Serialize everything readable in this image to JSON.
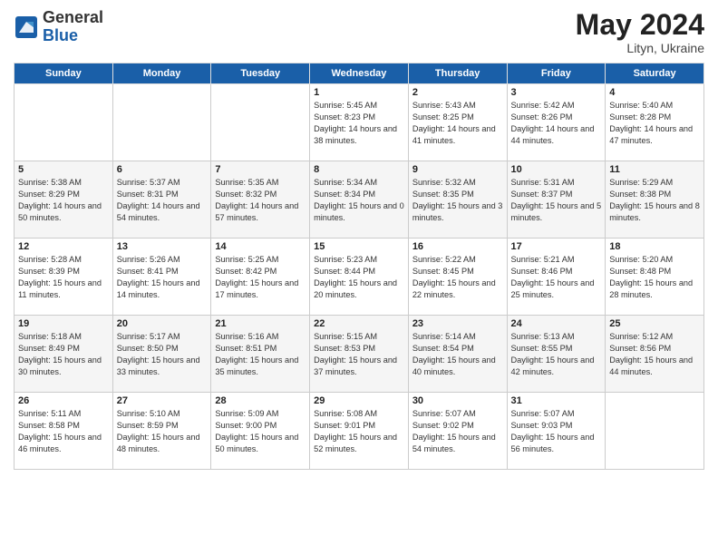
{
  "header": {
    "logo": {
      "line1": "General",
      "line2": "Blue"
    },
    "title": "May 2024",
    "location": "Lityn, Ukraine"
  },
  "weekdays": [
    "Sunday",
    "Monday",
    "Tuesday",
    "Wednesday",
    "Thursday",
    "Friday",
    "Saturday"
  ],
  "weeks": [
    [
      {
        "day": "",
        "sunrise": "",
        "sunset": "",
        "daylight": ""
      },
      {
        "day": "",
        "sunrise": "",
        "sunset": "",
        "daylight": ""
      },
      {
        "day": "",
        "sunrise": "",
        "sunset": "",
        "daylight": ""
      },
      {
        "day": "1",
        "sunrise": "Sunrise: 5:45 AM",
        "sunset": "Sunset: 8:23 PM",
        "daylight": "Daylight: 14 hours and 38 minutes."
      },
      {
        "day": "2",
        "sunrise": "Sunrise: 5:43 AM",
        "sunset": "Sunset: 8:25 PM",
        "daylight": "Daylight: 14 hours and 41 minutes."
      },
      {
        "day": "3",
        "sunrise": "Sunrise: 5:42 AM",
        "sunset": "Sunset: 8:26 PM",
        "daylight": "Daylight: 14 hours and 44 minutes."
      },
      {
        "day": "4",
        "sunrise": "Sunrise: 5:40 AM",
        "sunset": "Sunset: 8:28 PM",
        "daylight": "Daylight: 14 hours and 47 minutes."
      }
    ],
    [
      {
        "day": "5",
        "sunrise": "Sunrise: 5:38 AM",
        "sunset": "Sunset: 8:29 PM",
        "daylight": "Daylight: 14 hours and 50 minutes."
      },
      {
        "day": "6",
        "sunrise": "Sunrise: 5:37 AM",
        "sunset": "Sunset: 8:31 PM",
        "daylight": "Daylight: 14 hours and 54 minutes."
      },
      {
        "day": "7",
        "sunrise": "Sunrise: 5:35 AM",
        "sunset": "Sunset: 8:32 PM",
        "daylight": "Daylight: 14 hours and 57 minutes."
      },
      {
        "day": "8",
        "sunrise": "Sunrise: 5:34 AM",
        "sunset": "Sunset: 8:34 PM",
        "daylight": "Daylight: 15 hours and 0 minutes."
      },
      {
        "day": "9",
        "sunrise": "Sunrise: 5:32 AM",
        "sunset": "Sunset: 8:35 PM",
        "daylight": "Daylight: 15 hours and 3 minutes."
      },
      {
        "day": "10",
        "sunrise": "Sunrise: 5:31 AM",
        "sunset": "Sunset: 8:37 PM",
        "daylight": "Daylight: 15 hours and 5 minutes."
      },
      {
        "day": "11",
        "sunrise": "Sunrise: 5:29 AM",
        "sunset": "Sunset: 8:38 PM",
        "daylight": "Daylight: 15 hours and 8 minutes."
      }
    ],
    [
      {
        "day": "12",
        "sunrise": "Sunrise: 5:28 AM",
        "sunset": "Sunset: 8:39 PM",
        "daylight": "Daylight: 15 hours and 11 minutes."
      },
      {
        "day": "13",
        "sunrise": "Sunrise: 5:26 AM",
        "sunset": "Sunset: 8:41 PM",
        "daylight": "Daylight: 15 hours and 14 minutes."
      },
      {
        "day": "14",
        "sunrise": "Sunrise: 5:25 AM",
        "sunset": "Sunset: 8:42 PM",
        "daylight": "Daylight: 15 hours and 17 minutes."
      },
      {
        "day": "15",
        "sunrise": "Sunrise: 5:23 AM",
        "sunset": "Sunset: 8:44 PM",
        "daylight": "Daylight: 15 hours and 20 minutes."
      },
      {
        "day": "16",
        "sunrise": "Sunrise: 5:22 AM",
        "sunset": "Sunset: 8:45 PM",
        "daylight": "Daylight: 15 hours and 22 minutes."
      },
      {
        "day": "17",
        "sunrise": "Sunrise: 5:21 AM",
        "sunset": "Sunset: 8:46 PM",
        "daylight": "Daylight: 15 hours and 25 minutes."
      },
      {
        "day": "18",
        "sunrise": "Sunrise: 5:20 AM",
        "sunset": "Sunset: 8:48 PM",
        "daylight": "Daylight: 15 hours and 28 minutes."
      }
    ],
    [
      {
        "day": "19",
        "sunrise": "Sunrise: 5:18 AM",
        "sunset": "Sunset: 8:49 PM",
        "daylight": "Daylight: 15 hours and 30 minutes."
      },
      {
        "day": "20",
        "sunrise": "Sunrise: 5:17 AM",
        "sunset": "Sunset: 8:50 PM",
        "daylight": "Daylight: 15 hours and 33 minutes."
      },
      {
        "day": "21",
        "sunrise": "Sunrise: 5:16 AM",
        "sunset": "Sunset: 8:51 PM",
        "daylight": "Daylight: 15 hours and 35 minutes."
      },
      {
        "day": "22",
        "sunrise": "Sunrise: 5:15 AM",
        "sunset": "Sunset: 8:53 PM",
        "daylight": "Daylight: 15 hours and 37 minutes."
      },
      {
        "day": "23",
        "sunrise": "Sunrise: 5:14 AM",
        "sunset": "Sunset: 8:54 PM",
        "daylight": "Daylight: 15 hours and 40 minutes."
      },
      {
        "day": "24",
        "sunrise": "Sunrise: 5:13 AM",
        "sunset": "Sunset: 8:55 PM",
        "daylight": "Daylight: 15 hours and 42 minutes."
      },
      {
        "day": "25",
        "sunrise": "Sunrise: 5:12 AM",
        "sunset": "Sunset: 8:56 PM",
        "daylight": "Daylight: 15 hours and 44 minutes."
      }
    ],
    [
      {
        "day": "26",
        "sunrise": "Sunrise: 5:11 AM",
        "sunset": "Sunset: 8:58 PM",
        "daylight": "Daylight: 15 hours and 46 minutes."
      },
      {
        "day": "27",
        "sunrise": "Sunrise: 5:10 AM",
        "sunset": "Sunset: 8:59 PM",
        "daylight": "Daylight: 15 hours and 48 minutes."
      },
      {
        "day": "28",
        "sunrise": "Sunrise: 5:09 AM",
        "sunset": "Sunset: 9:00 PM",
        "daylight": "Daylight: 15 hours and 50 minutes."
      },
      {
        "day": "29",
        "sunrise": "Sunrise: 5:08 AM",
        "sunset": "Sunset: 9:01 PM",
        "daylight": "Daylight: 15 hours and 52 minutes."
      },
      {
        "day": "30",
        "sunrise": "Sunrise: 5:07 AM",
        "sunset": "Sunset: 9:02 PM",
        "daylight": "Daylight: 15 hours and 54 minutes."
      },
      {
        "day": "31",
        "sunrise": "Sunrise: 5:07 AM",
        "sunset": "Sunset: 9:03 PM",
        "daylight": "Daylight: 15 hours and 56 minutes."
      },
      {
        "day": "",
        "sunrise": "",
        "sunset": "",
        "daylight": ""
      }
    ]
  ]
}
